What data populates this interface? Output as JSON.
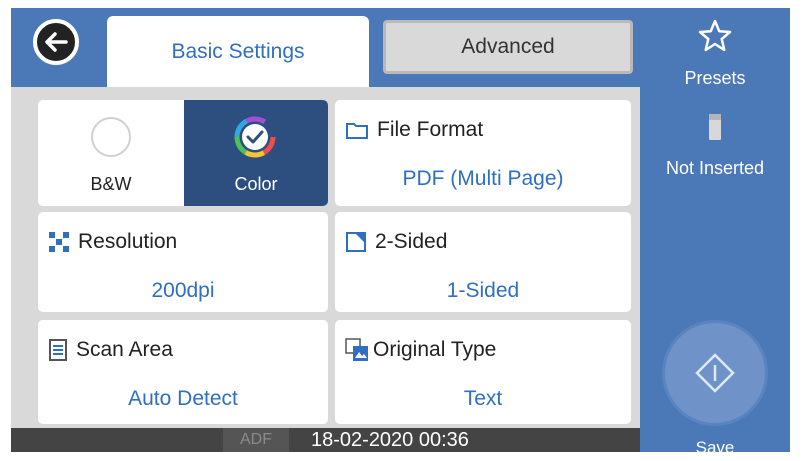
{
  "tabs": {
    "basic": "Basic Settings",
    "advanced": "Advanced"
  },
  "color_mode": {
    "bw_label": "B&W",
    "color_label": "Color",
    "selected": "Color"
  },
  "file_format": {
    "title": "File Format",
    "value": "PDF (Multi Page)"
  },
  "resolution": {
    "title": "Resolution",
    "value": "200dpi"
  },
  "two_sided": {
    "title": "2-Sided",
    "value": "1-Sided"
  },
  "scan_area": {
    "title": "Scan Area",
    "value": "Auto Detect"
  },
  "original_type": {
    "title": "Original Type",
    "value": "Text"
  },
  "status": {
    "adf": "ADF",
    "datetime": "18-02-2020 00:36"
  },
  "sidebar": {
    "presets_label": "Presets",
    "memory_label": "Not Inserted",
    "save_label": "Save"
  },
  "colors": {
    "accent_blue": "#4b78b6",
    "value_blue": "#2f6fc1",
    "selected_dark": "#2c4f80"
  },
  "icons": [
    "back-arrow-icon",
    "color-check-icon",
    "folder-icon",
    "resolution-icon",
    "two-sided-icon",
    "scan-area-icon",
    "original-type-icon",
    "star-icon",
    "memory-device-icon",
    "start-icon"
  ]
}
